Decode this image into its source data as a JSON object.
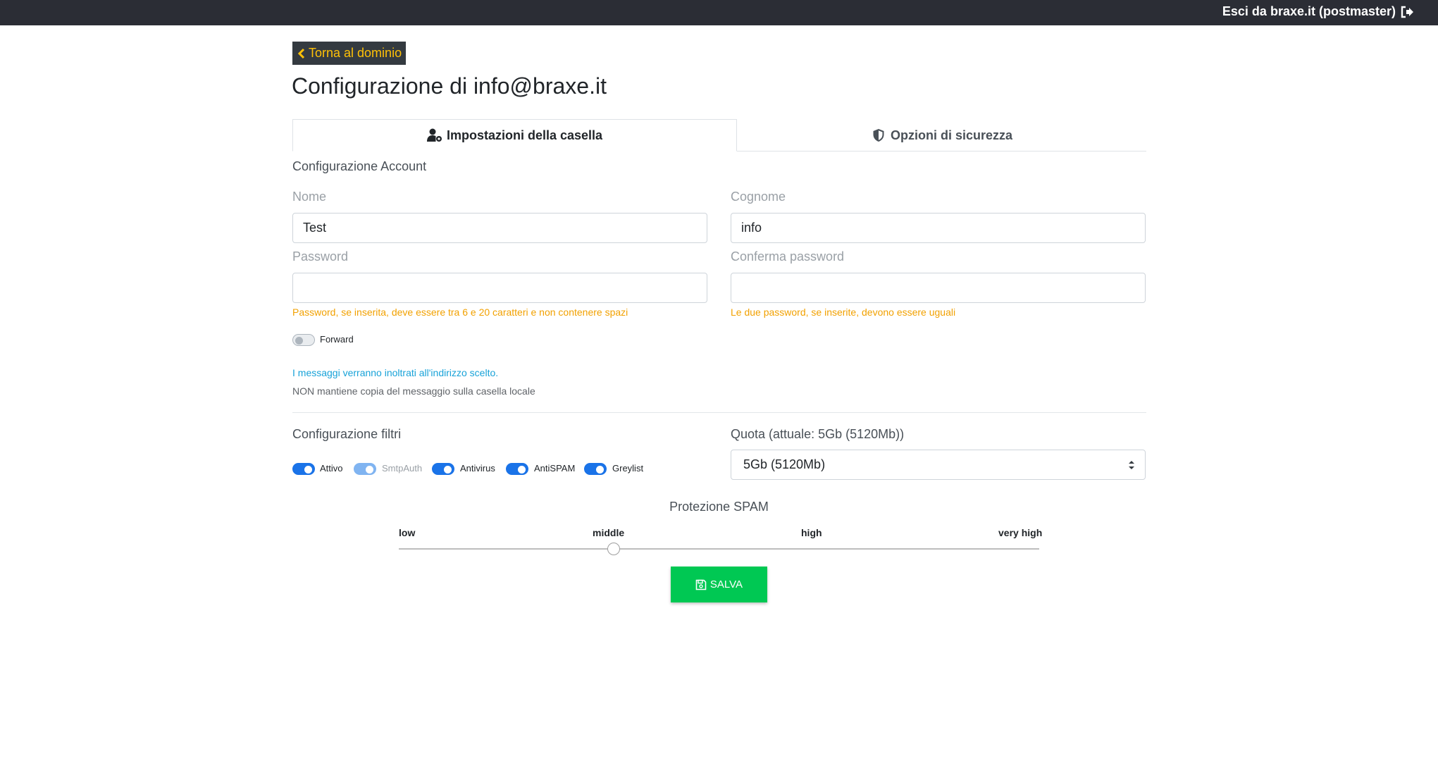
{
  "header": {
    "logout_label": "Esci da braxe.it (postmaster)"
  },
  "nav": {
    "back_label": "Torna al dominio"
  },
  "page": {
    "title_prefix": "Configurazione di",
    "title_email": "info@braxe.it"
  },
  "tabs": [
    {
      "label": "Impostazioni della casella",
      "icon": "user-gear-icon",
      "active": true
    },
    {
      "label": "Opzioni di sicurezza",
      "icon": "shield-icon",
      "active": false
    }
  ],
  "account": {
    "section_title": "Configurazione Account",
    "first_name": {
      "label": "Nome",
      "value": "Test"
    },
    "last_name": {
      "label": "Cognome",
      "value": "info"
    },
    "password": {
      "label": "Password",
      "value": "",
      "hint": "Password, se inserita, deve essere tra 6 e 20 caratteri e non contenere spazi"
    },
    "confirm_password": {
      "label": "Conferma password",
      "value": "",
      "hint": "Le due password, se inserite, devono essere uguali"
    },
    "forward": {
      "label": "Forward",
      "enabled": false
    },
    "forward_info": "I messaggi verranno inoltrati all'indirizzo scelto.",
    "forward_note": "NON mantiene copia del messaggio sulla casella locale"
  },
  "filters": {
    "section_title": "Configurazione filtri",
    "toggles": [
      {
        "label": "Attivo",
        "enabled": true
      },
      {
        "label": "SmtpAuth",
        "enabled": true,
        "disabled": true
      },
      {
        "label": "Antivirus",
        "enabled": true
      },
      {
        "label": "AntiSPAM",
        "enabled": true
      },
      {
        "label": "Greylist",
        "enabled": true
      }
    ]
  },
  "quota": {
    "label": "Quota (attuale: 5Gb (5120Mb))",
    "selected": "5Gb (5120Mb)"
  },
  "spam_protection": {
    "title": "Protezione SPAM",
    "levels": [
      "low",
      "middle",
      "high",
      "very high"
    ],
    "selected": "middle"
  },
  "actions": {
    "save_label": "SALVA"
  },
  "colors": {
    "topbar": "#2b2d35",
    "back_button_text": "#ffc107",
    "toggle_on": "#1a73e8",
    "hint": "#f2a100",
    "info_link": "#17a2d8",
    "save": "#00c853"
  }
}
